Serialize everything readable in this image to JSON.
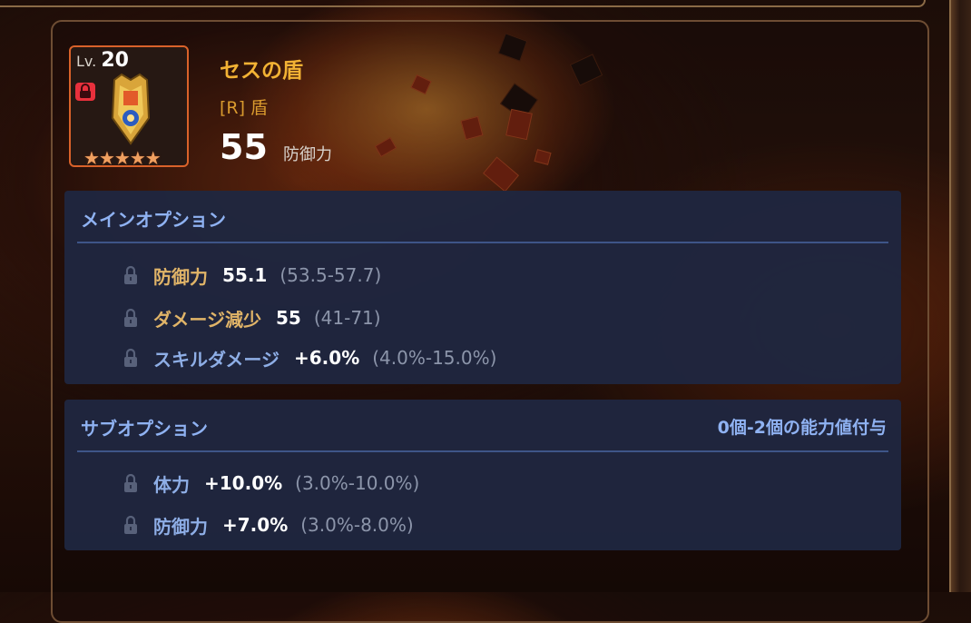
{
  "item": {
    "level_label": "Lv.",
    "level": "20",
    "name": "セスの盾",
    "type": "[R] 盾",
    "power_value": "55",
    "power_label": "防御力",
    "star_count": 5,
    "locked": true
  },
  "main_option": {
    "title": "メインオプション",
    "stats": [
      {
        "name": "防御力",
        "value": "55.1",
        "range": "(53.5-57.7)",
        "color": "gold"
      },
      {
        "name": "ダメージ減少",
        "value": "55",
        "range": "(41-71)",
        "color": "gold"
      },
      {
        "name": "スキルダメージ",
        "value": "+6.0%",
        "range": "(4.0%-15.0%)",
        "color": "blue"
      }
    ]
  },
  "sub_option": {
    "title": "サブオプション",
    "note": "0個-2個の能力値付与",
    "stats": [
      {
        "name": "体力",
        "value": "+10.0%",
        "range": "(3.0%-10.0%)",
        "color": "blue"
      },
      {
        "name": "防御力",
        "value": "+7.0%",
        "range": "(3.0%-8.0%)",
        "color": "blue"
      }
    ]
  },
  "colors": {
    "item_name": "#f2b234",
    "frame_rarity": "#d9622a",
    "panel_bg": "#1f2640",
    "section_title": "#8fb2f2",
    "stat_gold": "#e0b468",
    "stat_blue": "#8eaee6",
    "range_gray": "#8c95aa"
  },
  "icons": {
    "lock_status": "padlock-red-icon",
    "option_lock": "padlock-gray-icon",
    "item_image": "shield-icon",
    "rarity": "star-icon"
  }
}
